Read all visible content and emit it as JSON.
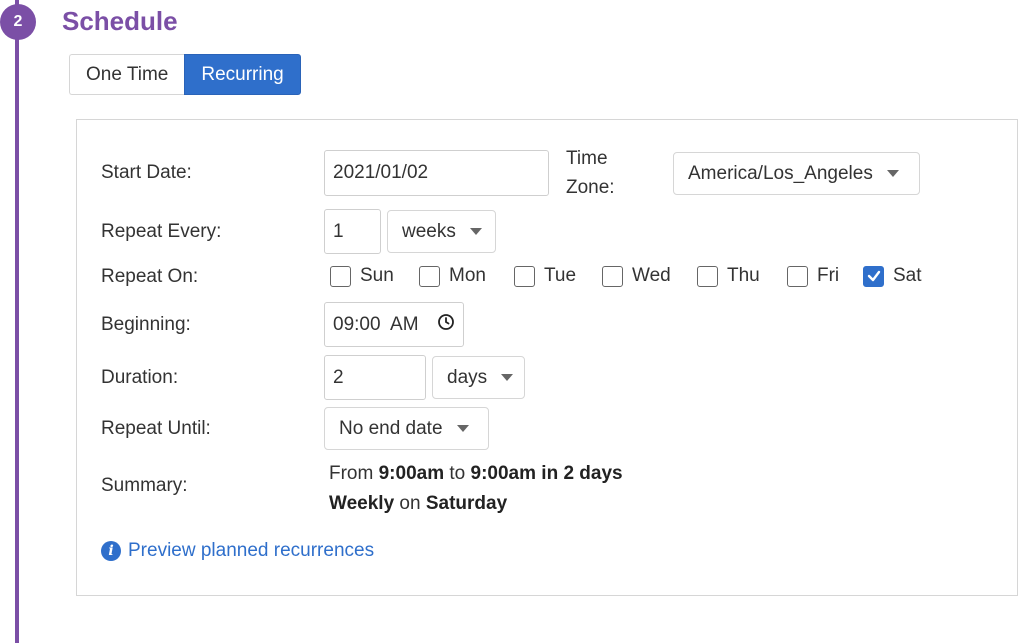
{
  "step": {
    "number": "2",
    "title": "Schedule"
  },
  "tabs": [
    {
      "label": "One Time",
      "active": false
    },
    {
      "label": "Recurring",
      "active": true
    }
  ],
  "form": {
    "start_date": {
      "label": "Start Date:",
      "value": "2021/01/02"
    },
    "time_zone": {
      "label_line1": "Time",
      "label_line2": "Zone:",
      "value": "America/Los_Angeles"
    },
    "repeat_every": {
      "label": "Repeat Every:",
      "value": "1",
      "unit": "weeks"
    },
    "repeat_on": {
      "label": "Repeat On:",
      "days": [
        {
          "label": "Sun",
          "checked": false
        },
        {
          "label": "Mon",
          "checked": false
        },
        {
          "label": "Tue",
          "checked": false
        },
        {
          "label": "Wed",
          "checked": false
        },
        {
          "label": "Thu",
          "checked": false
        },
        {
          "label": "Fri",
          "checked": false
        },
        {
          "label": "Sat",
          "checked": true
        }
      ]
    },
    "beginning": {
      "label": "Beginning:",
      "value": "09:00  AM"
    },
    "duration": {
      "label": "Duration:",
      "value": "2",
      "unit": "days"
    },
    "repeat_until": {
      "label": "Repeat Until:",
      "value": "No end date"
    },
    "summary": {
      "label": "Summary:",
      "from_word": "From",
      "start_time": "9:00am",
      "to_word": "to",
      "end_text": "9:00am in 2 days",
      "frequency": "Weekly",
      "on_word": "on",
      "day": "Saturday"
    }
  },
  "preview_link": {
    "label": "Preview planned recurrences",
    "icon": "info-circle-icon"
  },
  "colors": {
    "accent": "#7b4fa6",
    "primary": "#2f6fcb"
  }
}
